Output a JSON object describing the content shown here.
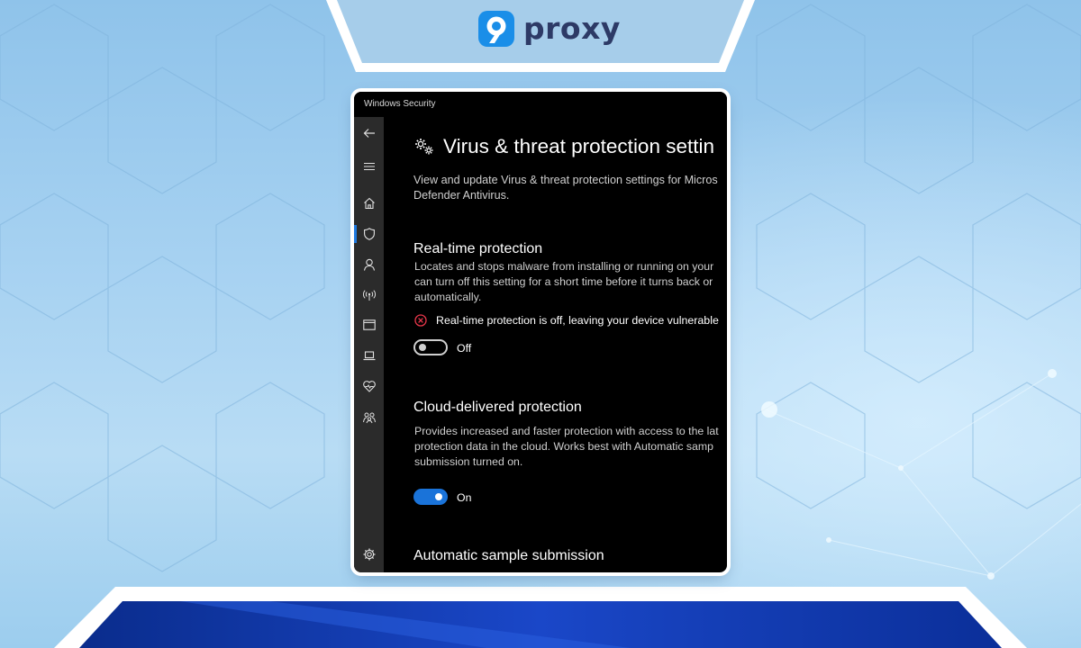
{
  "brand": {
    "name": "proxy",
    "mark_color": "#1a8ee8",
    "text_color": "#2d3a66"
  },
  "window": {
    "title": "Windows Security"
  },
  "nav": [
    {
      "icon": "back-arrow-icon"
    },
    {
      "icon": "hamburger-menu-icon"
    },
    {
      "icon": "home-icon"
    },
    {
      "icon": "shield-icon",
      "active": true
    },
    {
      "icon": "person-icon"
    },
    {
      "icon": "wireless-antenna-icon"
    },
    {
      "icon": "browser-window-icon"
    },
    {
      "icon": "laptop-icon"
    },
    {
      "icon": "heart-pulse-icon"
    },
    {
      "icon": "family-icon"
    },
    {
      "icon": "gear-icon"
    }
  ],
  "page": {
    "title": "Virus & threat protection settin",
    "intro": [
      "View and update Virus & threat protection settings for Micros",
      "Defender Antivirus."
    ]
  },
  "realtime": {
    "heading": "Real-time protection",
    "description": [
      "Locates and stops malware from installing or running on your",
      "can turn off this setting for a short time before it turns back or",
      "automatically."
    ],
    "warning": "Real-time protection is off, leaving your device vulnerable",
    "toggle_state": "Off"
  },
  "cloud": {
    "heading": "Cloud-delivered protection",
    "description": [
      "Provides increased and faster protection with access to the lat",
      "protection data in the cloud. Works best with Automatic samp",
      "submission turned on."
    ],
    "toggle_state": "On"
  },
  "sample": {
    "heading": "Automatic sample submission"
  },
  "colors": {
    "accent": "#1a73d9",
    "warning": "#e8364a",
    "nav_bg": "#2b2b2b",
    "window_bg": "#000000"
  }
}
